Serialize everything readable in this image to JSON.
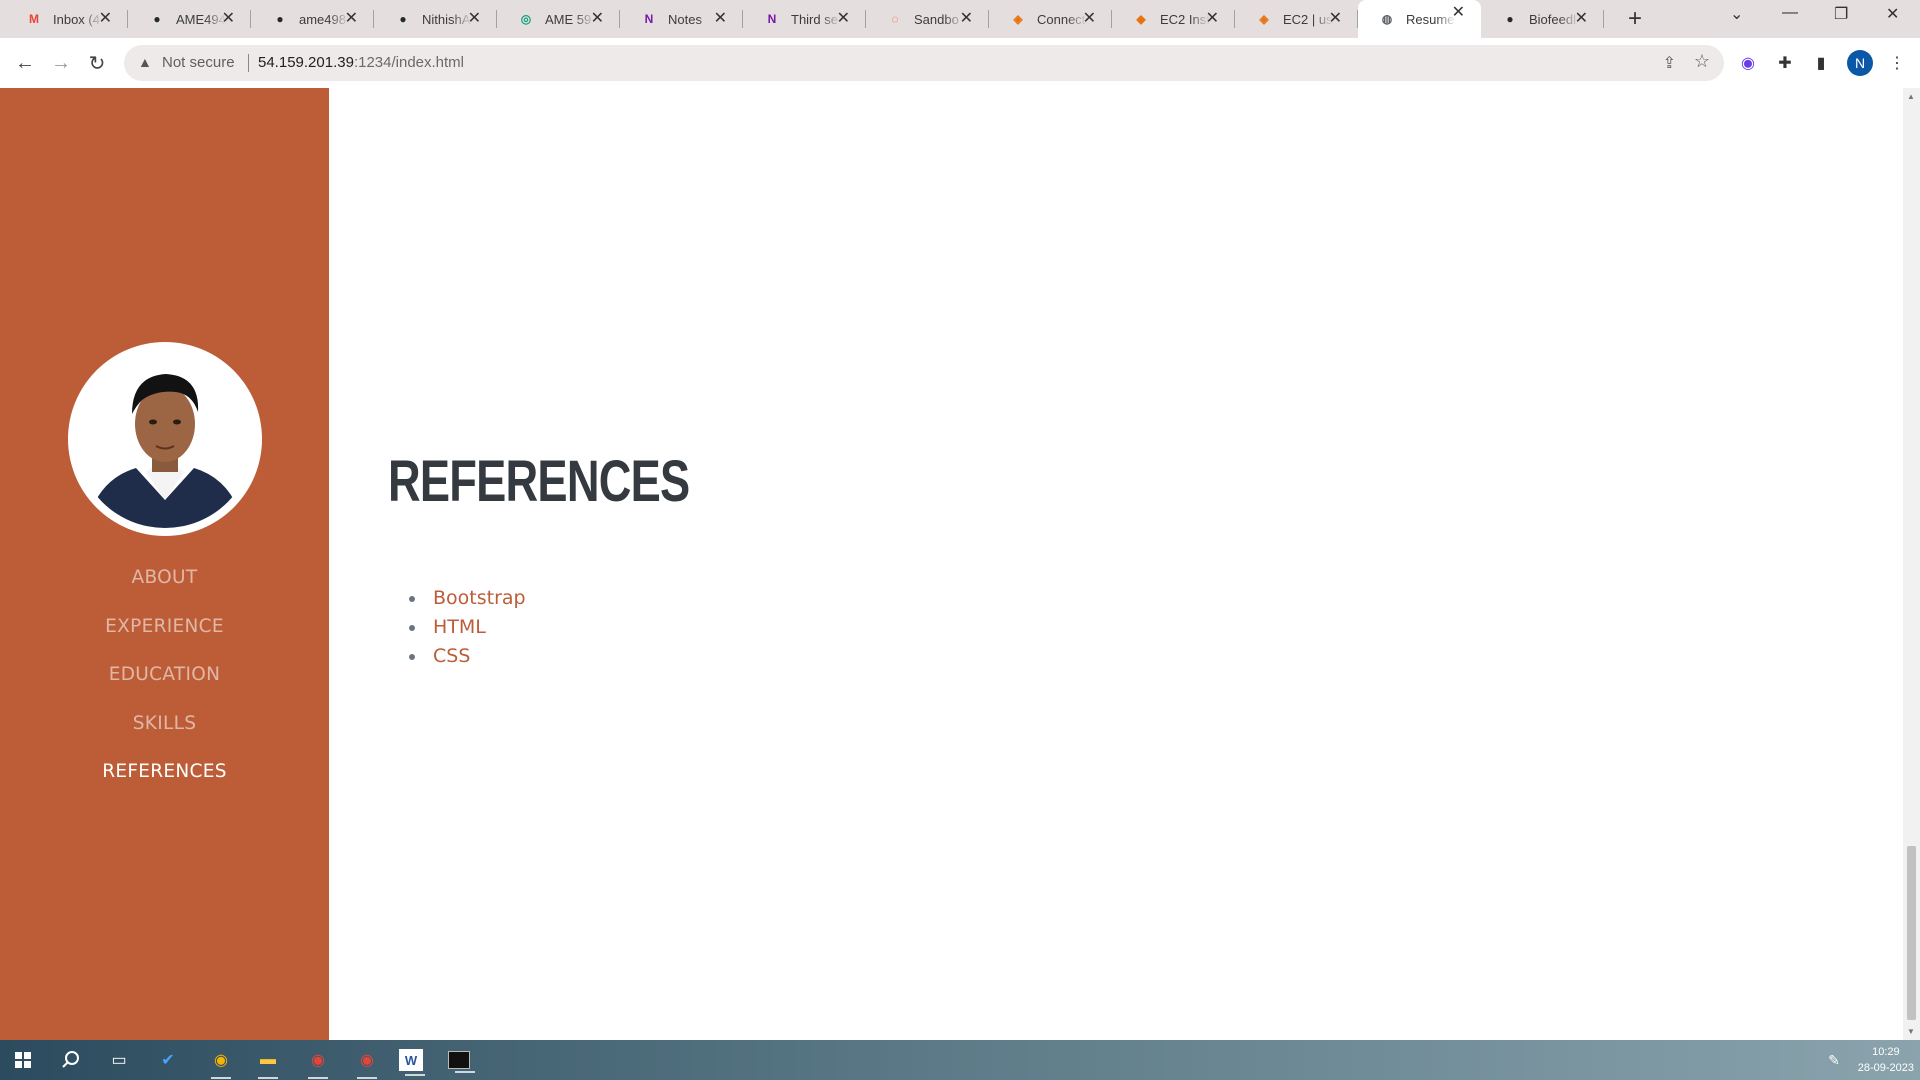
{
  "browser": {
    "tabs": [
      {
        "title": "Inbox (4",
        "icon": "gmail-icon",
        "color": "#ea4335",
        "glyph": "M"
      },
      {
        "title": "AME494",
        "icon": "github-icon",
        "color": "#24292f",
        "glyph": "●"
      },
      {
        "title": "ame498",
        "icon": "github-icon",
        "color": "#24292f",
        "glyph": "●"
      },
      {
        "title": "NithishA",
        "icon": "github-icon",
        "color": "#24292f",
        "glyph": "●"
      },
      {
        "title": "AME 59",
        "icon": "chatgpt-icon",
        "color": "#10a37f",
        "glyph": "◎"
      },
      {
        "title": "Notes",
        "icon": "onenote-icon",
        "color": "#7719aa",
        "glyph": "N"
      },
      {
        "title": "Third se",
        "icon": "onenote-icon",
        "color": "#7719aa",
        "glyph": "N"
      },
      {
        "title": "Sandbo",
        "icon": "ubuntu-icon",
        "color": "#e95420",
        "glyph": "◌"
      },
      {
        "title": "Connect",
        "icon": "aws-icon",
        "color": "#e8720c",
        "glyph": "◈"
      },
      {
        "title": "EC2 Inst",
        "icon": "aws-ec2-icon",
        "color": "#e8720c",
        "glyph": "◆"
      },
      {
        "title": "EC2 | us",
        "icon": "aws-icon",
        "color": "#e8720c",
        "glyph": "◈"
      },
      {
        "title": "Resume",
        "icon": "globe-icon",
        "color": "#5f6368",
        "glyph": "◍",
        "active": true
      },
      {
        "title": "Biofeedl",
        "icon": "github-icon",
        "color": "#24292f",
        "glyph": "●"
      }
    ],
    "security_label": "Not secure",
    "url_host": "54.159.201.39",
    "url_rest": ":1234/index.html",
    "profile_initial": "N"
  },
  "sidebar": {
    "accent": "#bd5d38",
    "nav": [
      {
        "label": "ABOUT",
        "active": false
      },
      {
        "label": "EXPERIENCE",
        "active": false
      },
      {
        "label": "EDUCATION",
        "active": false
      },
      {
        "label": "SKILLS",
        "active": false
      },
      {
        "label": "REFERENCES",
        "active": true
      }
    ]
  },
  "main": {
    "heading": "REFERENCES",
    "references": [
      "Bootstrap",
      "HTML",
      "CSS"
    ]
  },
  "taskbar": {
    "time": "10:29",
    "date": "28-09-2023"
  }
}
